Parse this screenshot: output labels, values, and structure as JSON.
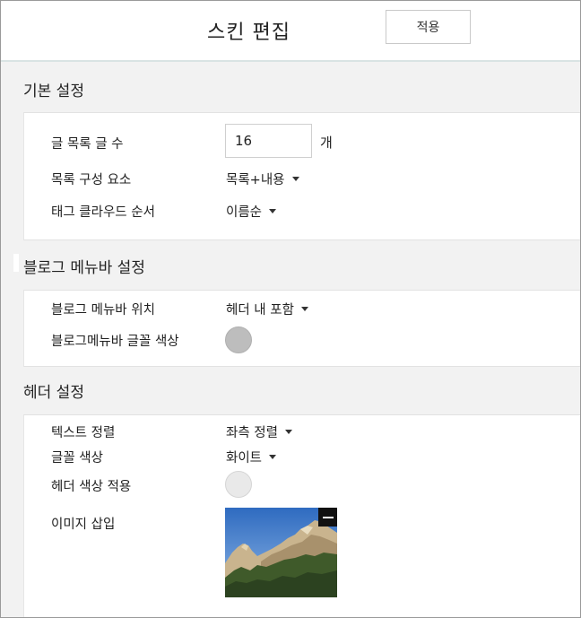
{
  "header": {
    "title": "스킨 편집",
    "apply_label": "적용"
  },
  "sections": {
    "basic": {
      "title": "기본 설정",
      "post_count": {
        "label": "글 목록 글 수",
        "value": "16",
        "unit": "개"
      },
      "list_composition": {
        "label": "목록 구성 요소",
        "value": "목록+내용"
      },
      "tag_cloud_order": {
        "label": "태그 클라우드 순서",
        "value": "이름순"
      }
    },
    "menubar": {
      "title": "블로그 메뉴바 설정",
      "position": {
        "label": "블로그 메뉴바 위치",
        "value": "헤더 내 포함"
      },
      "font_color": {
        "label": "블로그메뉴바 글꼴 색상",
        "color": "#bdbdbd"
      }
    },
    "header_settings": {
      "title": "헤더 설정",
      "text_align": {
        "label": "텍스트 정렬",
        "value": "좌측 정렬"
      },
      "font_color": {
        "label": "글꼴 색상",
        "value": "화이트"
      },
      "header_color": {
        "label": "헤더 색상 적용",
        "color": "#e9e9e9"
      },
      "image": {
        "label": "이미지 삽입"
      }
    }
  }
}
